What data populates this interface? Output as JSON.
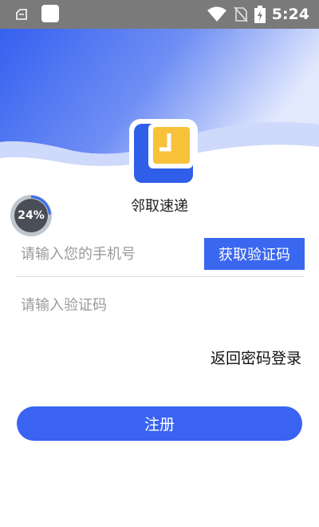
{
  "status_bar": {
    "time": "5:24",
    "icons": [
      "notification-icon",
      "app-square-icon",
      "wifi-icon",
      "no-sim-icon",
      "battery-charging-icon"
    ]
  },
  "app": {
    "name": "邻取速递"
  },
  "progress": {
    "label": "24%",
    "value": 0.24
  },
  "form": {
    "phone_placeholder": "请输入您的手机号",
    "get_code_label": "获取验证码",
    "code_placeholder": "请输入验证码",
    "back_to_password_label": "返回密码登录",
    "register_label": "注册"
  },
  "colors": {
    "primary": "#3a63f2",
    "logo_blue": "#2f5ee8",
    "logo_yellow": "#f7c23a",
    "status_bar": "#7a7a7a"
  }
}
